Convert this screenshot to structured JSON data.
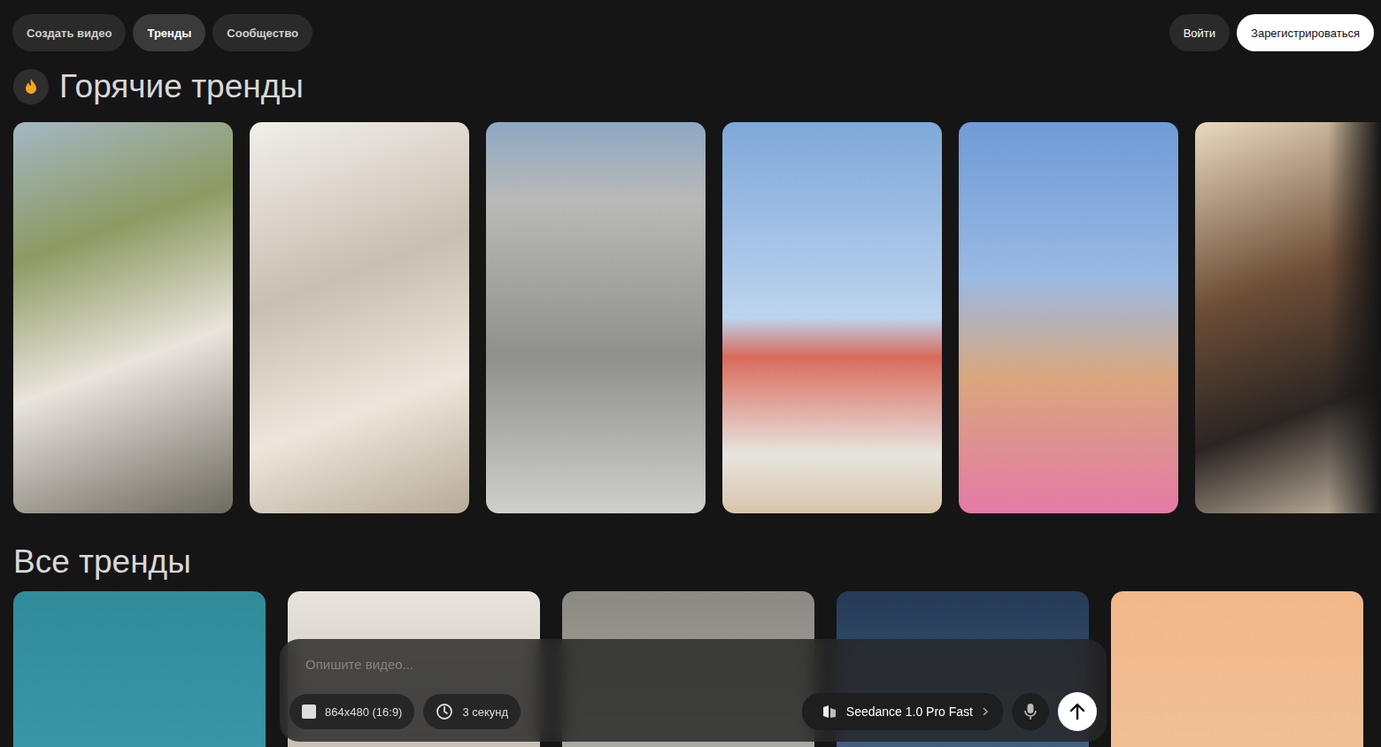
{
  "nav": {
    "tabs": [
      {
        "label": "Создать видео",
        "selected": false
      },
      {
        "label": "Тренды",
        "selected": true
      },
      {
        "label": "Сообщество",
        "selected": false
      }
    ],
    "login": "Войти",
    "register": "Зарегистрироваться"
  },
  "hot_trends": {
    "title": "Горячие тренды",
    "card_count": 6
  },
  "all_trends": {
    "title": "Все тренды",
    "card_count": 5
  },
  "prompt": {
    "placeholder": "Опишите видео...",
    "resolution": "864x480 (16:9)",
    "duration": "3 секунд",
    "model": "Seedance 1.0 Pro Fast"
  }
}
